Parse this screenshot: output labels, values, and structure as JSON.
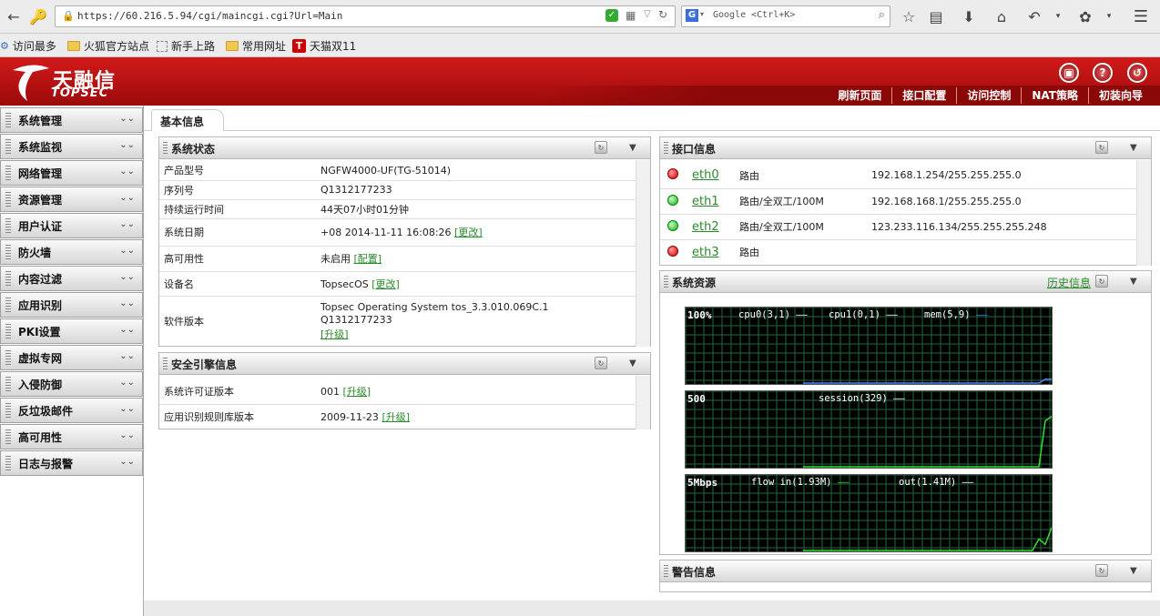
{
  "browser": {
    "url": "https://60.216.5.94/cgi/maincgi.cgi?Url=Main",
    "search_placeholder": "Google <Ctrl+K>",
    "search_engine": "G"
  },
  "bookmarks": [
    {
      "label": "访问最多"
    },
    {
      "label": "火狐官方站点"
    },
    {
      "label": "新手上路"
    },
    {
      "label": "常用网址"
    },
    {
      "label": "天猫双11",
      "badge": "T"
    }
  ],
  "header": {
    "logo_cn": "天融信",
    "logo_en": "TOPSEC",
    "nav": [
      "刷新页面",
      "接口配置",
      "访问控制",
      "NAT策略",
      "初装向导"
    ]
  },
  "sidebar": {
    "items": [
      "系统管理",
      "系统监视",
      "网络管理",
      "资源管理",
      "用户认证",
      "防火墙",
      "内容过滤",
      "应用识别",
      "PKI设置",
      "虚拟专网",
      "入侵防御",
      "反垃圾邮件",
      "高可用性",
      "日志与报警"
    ]
  },
  "tab": {
    "label": "基本信息"
  },
  "system_status": {
    "title": "系统状态",
    "rows": [
      {
        "key": "产品型号",
        "value": "NGFW4000-UF(TG-51014)",
        "link": ""
      },
      {
        "key": "序列号",
        "value": "Q1312177233",
        "link": ""
      },
      {
        "key": "持续运行时间",
        "value": "44天07小时01分钟",
        "link": ""
      },
      {
        "key": "系统日期",
        "value": "+08 2014-11-11 16:08:26",
        "link": "[更改]"
      },
      {
        "key": "高可用性",
        "value": "未启用",
        "link": "[配置]"
      },
      {
        "key": "设备名",
        "value": "TopsecOS",
        "link": "[更改]"
      }
    ],
    "version_key": "软件版本",
    "version_line1": "Topsec Operating System tos_3.3.010.069C.1",
    "version_line2": "Q1312177233",
    "version_link": "[升级]"
  },
  "engine_info": {
    "title": "安全引擎信息",
    "rows": [
      {
        "key": "系统许可证版本",
        "value": "001",
        "link": "[升级]"
      },
      {
        "key": "应用识别规则库版本",
        "value": "2009-11-23",
        "link": "[升级]"
      }
    ]
  },
  "interface_info": {
    "title": "接口信息",
    "rows": [
      {
        "name": "eth0",
        "status": "down",
        "mode": "路由",
        "ip": "192.168.1.254/255.255.255.0"
      },
      {
        "name": "eth1",
        "status": "up",
        "mode": "路由/全双工/100M",
        "ip": "192.168.168.1/255.255.255.0"
      },
      {
        "name": "eth2",
        "status": "up",
        "mode": "路由/全双工/100M",
        "ip": "123.233.116.134/255.255.255.248"
      },
      {
        "name": "eth3",
        "status": "down",
        "mode": "路由",
        "ip": ""
      }
    ]
  },
  "system_resources": {
    "title": "系统资源",
    "history_link": "历史信息",
    "graphs": [
      {
        "scale": "100%",
        "legend": [
          {
            "label": "cpu0(3,1)",
            "color": "#ffffff"
          },
          {
            "label": "cpu1(0,1)",
            "color": "#ffffff"
          },
          {
            "label": "mem(5,9)",
            "color": "#4a7cff"
          }
        ],
        "line_color": "#4a7cff",
        "values": [
          0,
          0,
          0,
          0,
          0,
          0,
          0,
          0,
          0,
          0,
          0,
          0,
          0,
          0,
          0,
          0,
          0,
          0,
          0,
          0,
          0,
          0,
          0,
          0,
          0,
          0,
          0,
          0,
          0,
          0,
          0,
          0,
          0,
          0,
          0,
          0,
          0,
          0,
          5,
          5
        ]
      },
      {
        "scale": "500",
        "legend": [
          {
            "label": "session(329)",
            "color": "#ffffff"
          }
        ],
        "line_color": "#33dd33",
        "values": [
          0,
          0,
          0,
          0,
          0,
          0,
          0,
          0,
          0,
          0,
          0,
          0,
          0,
          0,
          0,
          0,
          0,
          0,
          0,
          0,
          0,
          0,
          0,
          0,
          0,
          0,
          0,
          0,
          0,
          0,
          0,
          0,
          0,
          0,
          0,
          0,
          0,
          0,
          60,
          66
        ]
      },
      {
        "scale": "5Mbps",
        "legend": [
          {
            "label": "flow in(1.93M)",
            "color": "#33dd33"
          },
          {
            "label": "out(1.41M)",
            "color": "#ffffff"
          }
        ],
        "line_color": "#33dd33",
        "values": [
          0,
          0,
          0,
          0,
          0,
          0,
          0,
          0,
          0,
          0,
          0,
          0,
          0,
          0,
          0,
          0,
          0,
          0,
          0,
          0,
          0,
          0,
          0,
          0,
          0,
          0,
          0,
          0,
          0,
          0,
          0,
          0,
          0,
          0,
          0,
          0,
          0,
          15,
          8,
          30
        ]
      }
    ]
  },
  "alert_info": {
    "title": "警告信息"
  }
}
